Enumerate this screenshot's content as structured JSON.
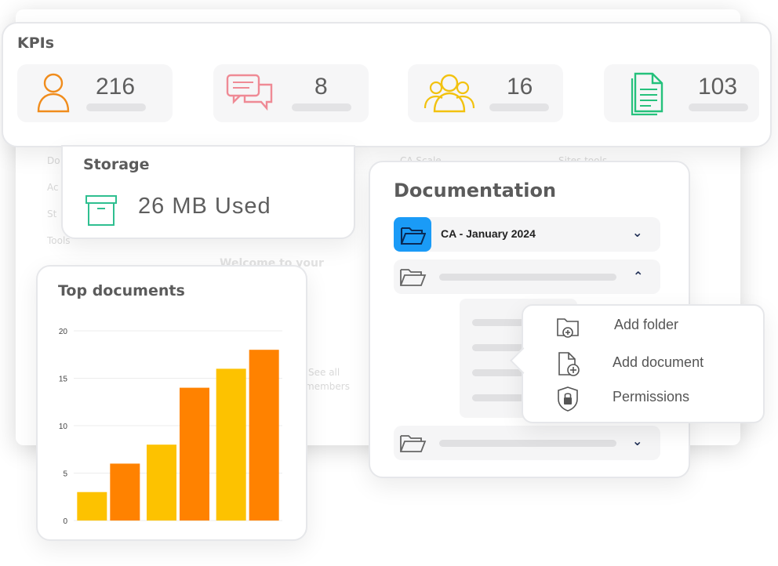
{
  "background_window": {
    "sidebar_items": [
      "Do",
      "Ac",
      "St",
      "Tools"
    ],
    "faint_texts": [
      "CA Scale",
      "Sites tools",
      "Welcome to your",
      "See all",
      "members"
    ]
  },
  "kpis": {
    "title": "KPIs",
    "tiles": [
      {
        "icon": "user-icon",
        "value": "216",
        "color": "#f08c1c"
      },
      {
        "icon": "chat-bubbles-icon",
        "value": "8",
        "color": "#ef8a95"
      },
      {
        "icon": "group-icon",
        "value": "16",
        "color": "#f2c20f"
      },
      {
        "icon": "document-icon",
        "value": "103",
        "color": "#25c17c"
      }
    ]
  },
  "storage": {
    "title": "Storage",
    "icon": "archive-box-icon",
    "used_label": "26 MB Used"
  },
  "documentation": {
    "title": "Documentation",
    "rows": [
      {
        "label": "CA - January 2024",
        "icon": "folder-open-icon",
        "state": "collapsed",
        "highlight": "#1a9bf7"
      },
      {
        "label": "",
        "icon": "folder-open-icon",
        "state": "expanded"
      },
      {
        "label": "",
        "icon": "folder-open-icon",
        "state": "collapsed"
      }
    ]
  },
  "context_menu": {
    "items": [
      {
        "label": "Add folder",
        "icon": "folder-plus-icon"
      },
      {
        "label": "Add document",
        "icon": "document-plus-icon"
      },
      {
        "label": "Permissions",
        "icon": "shield-lock-icon"
      }
    ]
  },
  "chart_data": {
    "type": "bar",
    "title": "Top documents",
    "xlabel": "",
    "ylabel": "",
    "ylim": [
      0,
      20
    ],
    "yticks": [
      0,
      5,
      10,
      15,
      20
    ],
    "values": [
      3,
      6,
      8,
      14,
      16,
      18
    ],
    "colors": [
      "#fdc200",
      "#ff8200",
      "#fdc200",
      "#ff8200",
      "#fdc200",
      "#ff8200"
    ]
  }
}
